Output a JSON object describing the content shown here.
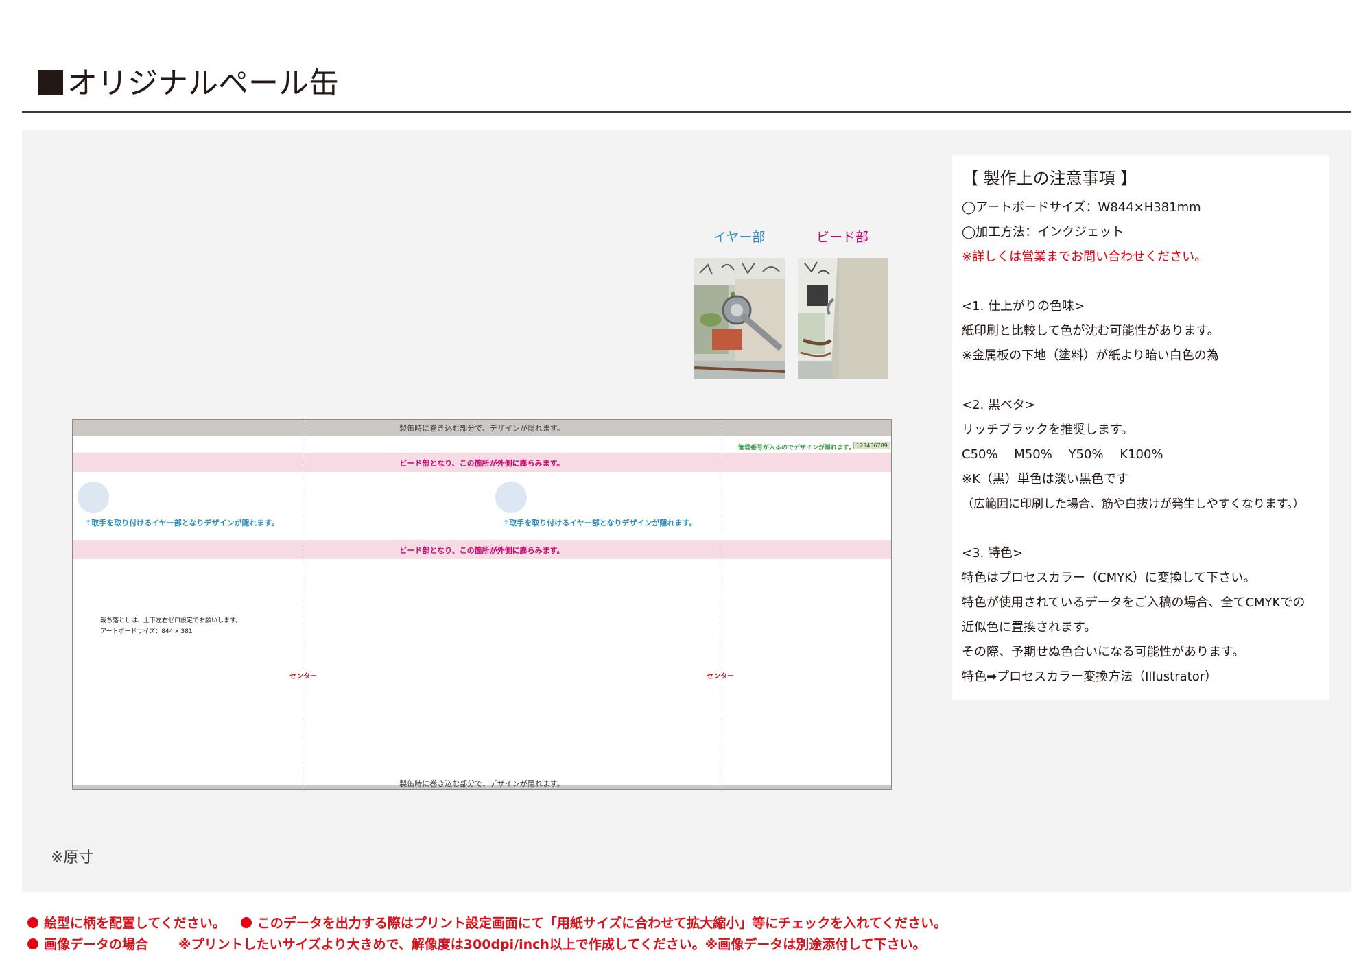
{
  "page": {
    "title": "オリジナルペール缶"
  },
  "artboard": {
    "wrap_text": "製缶時に巻き込む部分で、デザインが隠れます。",
    "bead_text": "ビード部となり、この箇所が外側に膨らみます。",
    "ear_text": "↑取手を取り付けるイヤー部となりデザインが隠れます。",
    "management_text": "管理番号が入るのでデザインが隠れます。→",
    "management_number": "123456789",
    "bleed_note": "裁ち落としは、上下左右ゼロ設定でお願いします。",
    "artboard_size_note": "アートボードサイズ：844 x 381",
    "center_label": "センター"
  },
  "photos": {
    "ear_label": "イヤー部",
    "bead_label": "ビード部",
    "ear_label_color": "#2a8fc2",
    "bead_label_color": "#d4006f"
  },
  "notes": {
    "heading": "【 製作上の注意事項 】",
    "lines": [
      "◯アートボードサイズ：W844×H381mm",
      "◯加工方法：インクジェット",
      "※詳しくは営業までお問い合わせください。",
      "<1. 仕上がりの色味>",
      "紙印刷と比較して色が沈む可能性があります。",
      "※金属板の下地（塗料）が紙より暗い白色の為",
      "<2. 黒ベタ>",
      "リッチブラックを推奨します。",
      "C50%　 M50%　 Y50%　 K100%",
      "※K（黒）単色は淡い黒色です",
      "（広範囲に印刷した場合、筋や白抜けが発生しやすくなります。）",
      "<3. 特色>",
      "特色はプロセスカラー（CMYK）に変換して下さい。",
      "特色が使用されているデータをご入稿の場合、全てCMYKでの",
      "近似色に置換されます。",
      "その際、予期せぬ色合いになる可能性があります。",
      "特色➡プロセスカラー変換方法（Illustrator）"
    ]
  },
  "scale_note": "※原寸",
  "footer": {
    "item1": "絵型に柄を配置してください。",
    "item2": "このデータを出力する際はプリント設定画面にて「用紙サイズに合わせて拡大縮小」等にチェックを入れてください。",
    "item3_label": "画像データの場合",
    "item3_detail": "※プリントしたいサイズより大きめで、解像度は300dpi/inch以上で作成してください。※画像データは別途添付して下さい。"
  },
  "colors": {
    "accent_red": "#e60012",
    "bead_pink": "#f6dbe5",
    "wrap_band": "#cdc8c4",
    "ear_blue": "#2a8fc2"
  }
}
